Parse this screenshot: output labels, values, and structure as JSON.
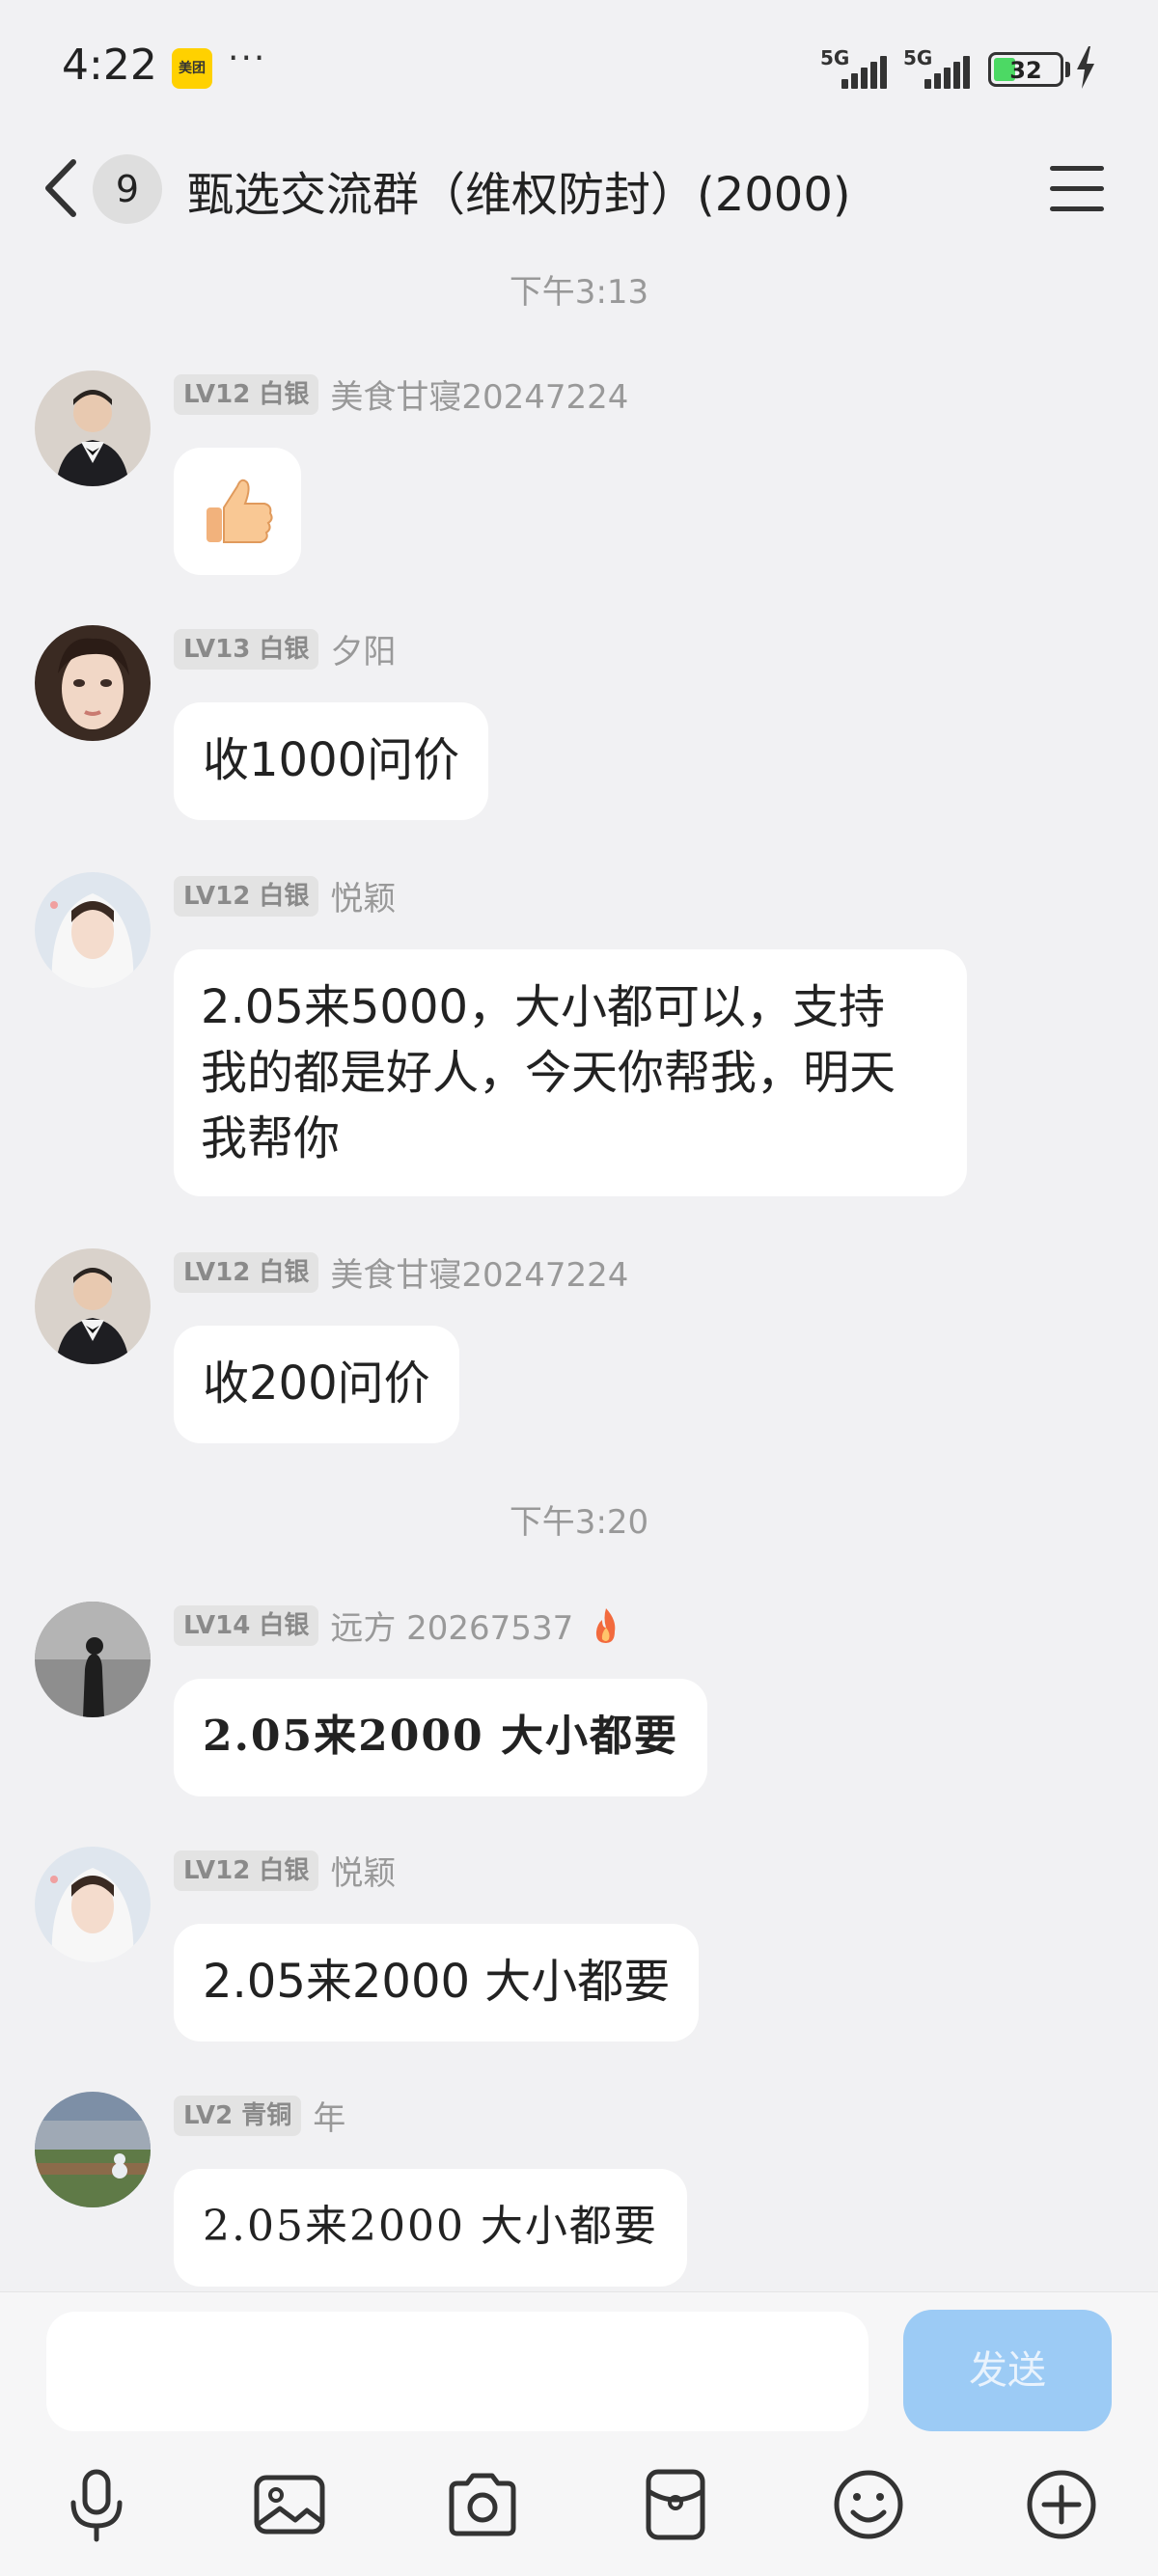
{
  "status_bar": {
    "time": "4:22",
    "app_badge": "美团",
    "more": "···",
    "network_1": "5G",
    "network_2": "5G",
    "battery_level": "32"
  },
  "header": {
    "unread_count": "9",
    "title": "甄选交流群（维权防封）(2000)"
  },
  "messages": [
    {
      "type": "time",
      "text": "下午3:13"
    },
    {
      "type": "msg",
      "level": "LV12 白银",
      "name": "美食甘寝20247224",
      "text": "",
      "emoji": "thumbs-up"
    },
    {
      "type": "msg",
      "level": "LV13 白银",
      "name": "夕阳",
      "text": "收1000问价"
    },
    {
      "type": "msg",
      "level": "LV12 白银",
      "name": "悦颖",
      "text_lines": [
        "2.05来5000，大小都可以，支持",
        "我的都是好人，今天你帮我，明天",
        "我帮你"
      ]
    },
    {
      "type": "msg",
      "level": "LV12 白银",
      "name": "美食甘寝20247224",
      "text": "收200问价"
    },
    {
      "type": "time",
      "text": "下午3:20"
    },
    {
      "type": "msg",
      "level": "LV14 白银",
      "name": "远方  20267537",
      "text": "2.05来2000  大小都要",
      "style": "brush"
    },
    {
      "type": "msg",
      "level": "LV12 白银",
      "name": "悦颖",
      "text": "2.05来2000  大小都要"
    },
    {
      "type": "msg",
      "level": "LV2 青铜",
      "name": "年",
      "text": "2.05来2000  大小都要",
      "style": "hand"
    }
  ],
  "input_bar": {
    "placeholder": "",
    "send_label": "发送"
  },
  "toolbar": [
    "mic-icon",
    "image-icon",
    "camera-icon",
    "red-packet-icon",
    "emoji-icon",
    "plus-icon"
  ],
  "colors": {
    "background": "#f1f1f3",
    "bubble": "#ffffff",
    "send_button": "#9ccbf5",
    "battery": "#4cd964"
  }
}
